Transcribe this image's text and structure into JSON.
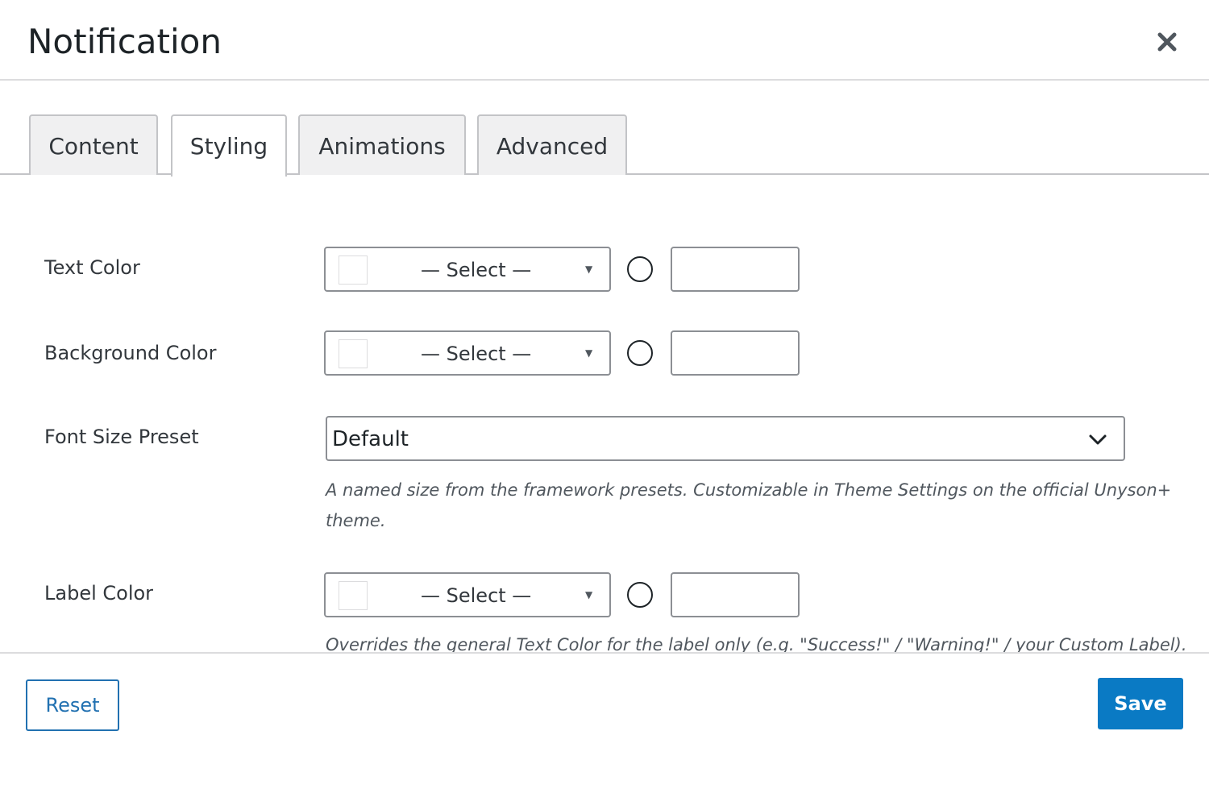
{
  "modal": {
    "title": "Notification",
    "close_icon": "close-icon"
  },
  "tabs": [
    {
      "label": "Content",
      "active": false
    },
    {
      "label": "Styling",
      "active": true
    },
    {
      "label": "Animations",
      "active": false
    },
    {
      "label": "Advanced",
      "active": false
    }
  ],
  "fields": {
    "text_color": {
      "label": "Text Color",
      "select_text": "— Select —",
      "hex_value": ""
    },
    "background_color": {
      "label": "Background Color",
      "select_text": "— Select —",
      "hex_value": ""
    },
    "font_size_preset": {
      "label": "Font Size Preset",
      "selected": "Default",
      "help": "A named size from the framework presets. Customizable in Theme Settings on the official Unyson+ theme."
    },
    "label_color": {
      "label": "Label Color",
      "select_text": "— Select —",
      "hex_value": "",
      "help": "Overrides the general Text Color for the label only (e.g. \"Success!\" / \"Warning!\" / your Custom Label)."
    }
  },
  "footer": {
    "reset_label": "Reset",
    "save_label": "Save"
  },
  "colors": {
    "accent": "#2271b1",
    "save_bg": "#0a7ac4",
    "border": "#8c8f94",
    "tab_bg": "#f0f0f1"
  }
}
